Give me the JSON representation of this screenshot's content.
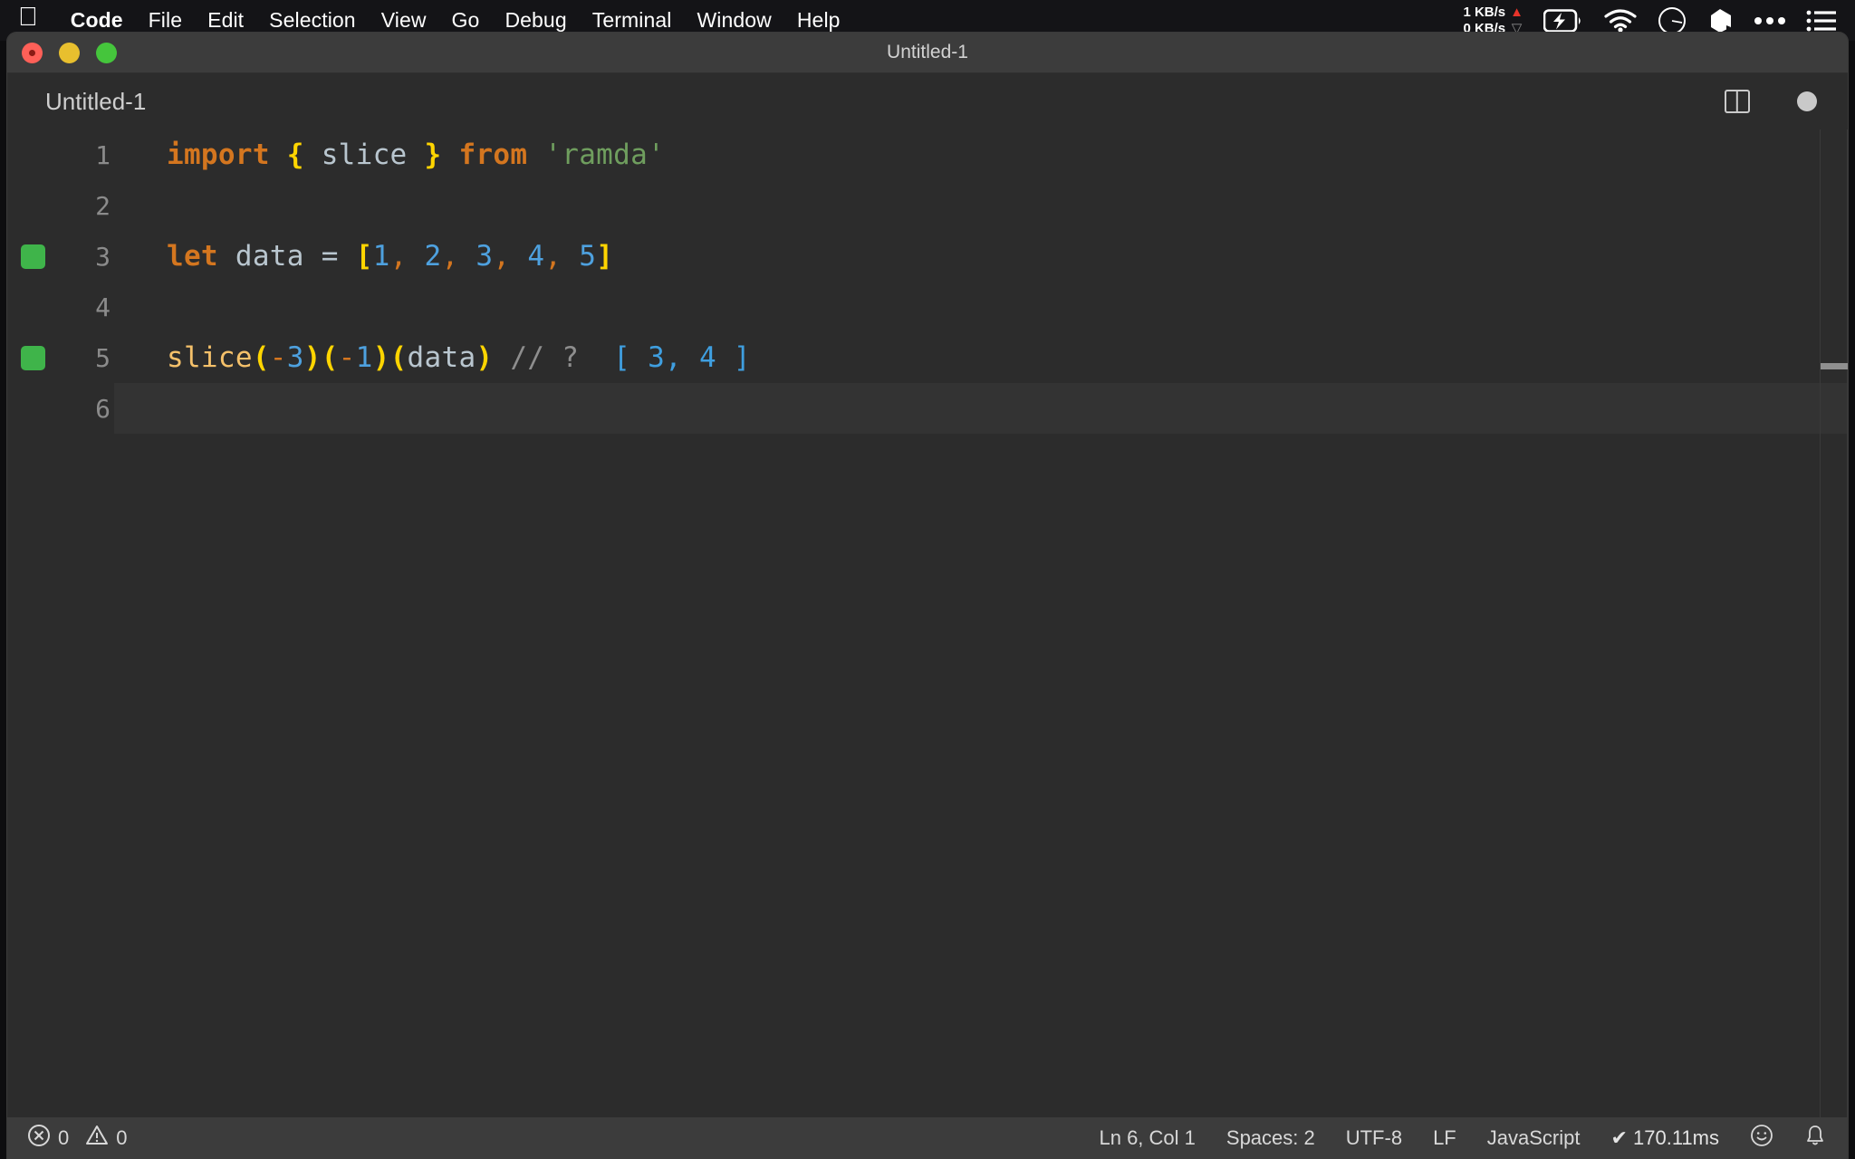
{
  "menubar": {
    "apple_icon": "apple-logo-icon",
    "items": [
      {
        "label": "Code",
        "bold": true
      },
      {
        "label": "File",
        "bold": false
      },
      {
        "label": "Edit",
        "bold": false
      },
      {
        "label": "Selection",
        "bold": false
      },
      {
        "label": "View",
        "bold": false
      },
      {
        "label": "Go",
        "bold": false
      },
      {
        "label": "Debug",
        "bold": false
      },
      {
        "label": "Terminal",
        "bold": false
      },
      {
        "label": "Window",
        "bold": false
      },
      {
        "label": "Help",
        "bold": false
      }
    ],
    "status": {
      "upload_speed": "1 KB/s",
      "download_speed": "0 KB/s",
      "upload_arrow": "▲",
      "download_arrow": "▽",
      "upload_color": "#e8342a",
      "download_color": "#8a8a8a",
      "icons": [
        "battery-charging-icon",
        "wifi-icon",
        "clock-icon",
        "dropbox-icon",
        "ellipsis-icon",
        "control-center-list-icon"
      ]
    }
  },
  "window": {
    "title": "Untitled-1",
    "traffic_lights": [
      {
        "name": "close",
        "color": "#ff6058",
        "has_dot": true
      },
      {
        "name": "minimize",
        "color": "#e8bf2e",
        "has_dot": false
      },
      {
        "name": "zoom",
        "color": "#45c53c",
        "has_dot": false
      }
    ]
  },
  "editor": {
    "tab_label": "Untitled-1",
    "actions": [
      {
        "name": "split-editor-icon",
        "label": "Split Editor"
      },
      {
        "name": "unsaved-indicator-icon",
        "label": "Unsaved changes"
      }
    ],
    "active_line": 6,
    "lines": [
      {
        "number": "1",
        "marker": false,
        "active": false,
        "tokens": [
          {
            "text": "import",
            "type": "keyword"
          },
          {
            "text": " ",
            "type": "plain"
          },
          {
            "text": "{",
            "type": "brace"
          },
          {
            "text": " ",
            "type": "plain"
          },
          {
            "text": "slice",
            "type": "ident"
          },
          {
            "text": " ",
            "type": "plain"
          },
          {
            "text": "}",
            "type": "brace"
          },
          {
            "text": " ",
            "type": "plain"
          },
          {
            "text": "from",
            "type": "keyword"
          },
          {
            "text": " ",
            "type": "plain"
          },
          {
            "text": "'ramda'",
            "type": "string"
          }
        ]
      },
      {
        "number": "2",
        "marker": false,
        "active": false,
        "tokens": []
      },
      {
        "number": "3",
        "marker": true,
        "active": false,
        "tokens": [
          {
            "text": "let",
            "type": "keyword"
          },
          {
            "text": " ",
            "type": "plain"
          },
          {
            "text": "data",
            "type": "ident"
          },
          {
            "text": " ",
            "type": "plain"
          },
          {
            "text": "=",
            "type": "operator"
          },
          {
            "text": " ",
            "type": "plain"
          },
          {
            "text": "[",
            "type": "brace"
          },
          {
            "text": "1",
            "type": "number"
          },
          {
            "text": ",",
            "type": "punct"
          },
          {
            "text": " ",
            "type": "plain"
          },
          {
            "text": "2",
            "type": "number"
          },
          {
            "text": ",",
            "type": "punct"
          },
          {
            "text": " ",
            "type": "plain"
          },
          {
            "text": "3",
            "type": "number"
          },
          {
            "text": ",",
            "type": "punct"
          },
          {
            "text": " ",
            "type": "plain"
          },
          {
            "text": "4",
            "type": "number"
          },
          {
            "text": ",",
            "type": "punct"
          },
          {
            "text": " ",
            "type": "plain"
          },
          {
            "text": "5",
            "type": "number"
          },
          {
            "text": "]",
            "type": "brace"
          }
        ]
      },
      {
        "number": "4",
        "marker": false,
        "active": false,
        "tokens": []
      },
      {
        "number": "5",
        "marker": true,
        "active": false,
        "tokens": [
          {
            "text": "slice",
            "type": "func"
          },
          {
            "text": "(",
            "type": "brace"
          },
          {
            "text": "-",
            "type": "punct"
          },
          {
            "text": "3",
            "type": "number"
          },
          {
            "text": ")",
            "type": "brace"
          },
          {
            "text": "(",
            "type": "brace"
          },
          {
            "text": "-",
            "type": "punct"
          },
          {
            "text": "1",
            "type": "number"
          },
          {
            "text": ")",
            "type": "brace"
          },
          {
            "text": "(",
            "type": "brace"
          },
          {
            "text": "data",
            "type": "ident"
          },
          {
            "text": ")",
            "type": "brace"
          },
          {
            "text": " ",
            "type": "plain"
          },
          {
            "text": "// ?",
            "type": "comment"
          },
          {
            "text": "  ",
            "type": "plain"
          },
          {
            "text": "[ 3, 4 ]",
            "type": "result"
          }
        ]
      },
      {
        "number": "6",
        "marker": false,
        "active": true,
        "tokens": []
      }
    ]
  },
  "statusbar": {
    "errors_icon": "error-circle-icon",
    "errors_count": "0",
    "warnings_icon": "warning-triangle-icon",
    "warnings_count": "0",
    "cursor_position": "Ln 6, Col 1",
    "indentation": "Spaces: 2",
    "encoding": "UTF-8",
    "line_ending": "LF",
    "language": "JavaScript",
    "quokka_status": "✔ 170.11ms",
    "feedback_icon": "smiley-icon",
    "notifications_icon": "bell-icon"
  }
}
